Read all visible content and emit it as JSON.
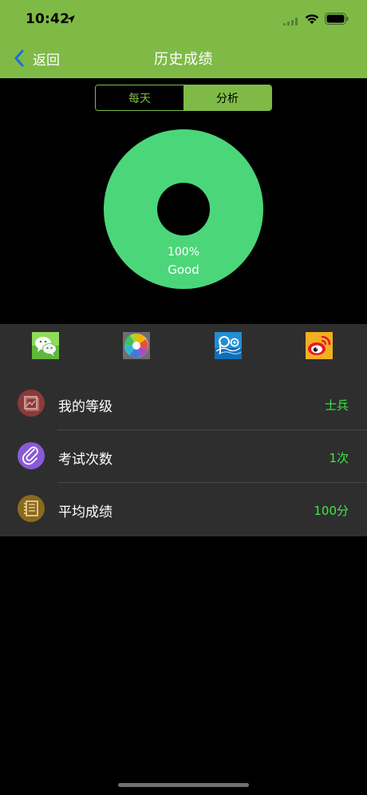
{
  "status_bar": {
    "time": "10:42"
  },
  "nav": {
    "back_label": "返回",
    "title": "历史成绩"
  },
  "segment": {
    "items": [
      "每天",
      "分析"
    ],
    "selected": "分析"
  },
  "chart_data": {
    "type": "pie",
    "categories": [
      "Good"
    ],
    "values": [
      100
    ],
    "percent_label": "100%",
    "category_label": "Good",
    "color": "#4cd67a"
  },
  "share": {
    "icons": [
      "wechat-icon",
      "moments-icon",
      "qzone-icon",
      "weibo-icon"
    ]
  },
  "stats": [
    {
      "label": "我的等级",
      "value": "士兵",
      "icon": "image-frame-icon",
      "icon_color": "#8a3a3a"
    },
    {
      "label": "考试次数",
      "value": "1次",
      "icon": "paperclip-icon",
      "icon_color": "#8a59d8"
    },
    {
      "label": "平均成绩",
      "value": "100分",
      "icon": "notebook-icon",
      "icon_color": "#8a6a1f"
    }
  ],
  "colors": {
    "accent": "#7fba47",
    "value_green": "#3ee845",
    "panel": "#2e2e2e",
    "background": "#000000"
  }
}
